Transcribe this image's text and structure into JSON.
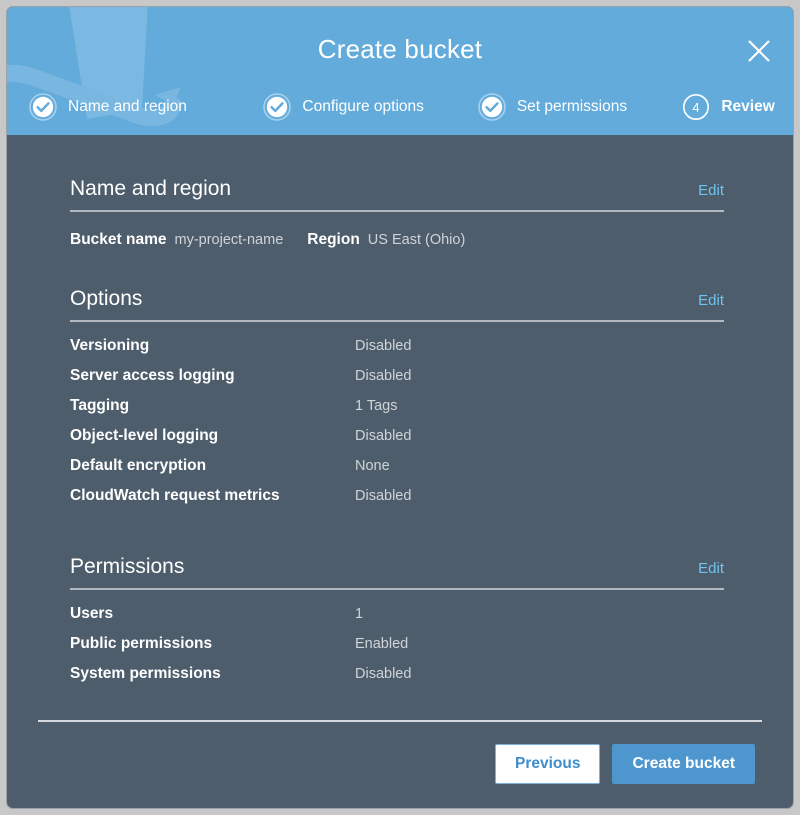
{
  "dialog": {
    "title": "Create bucket",
    "close_icon": "close-icon",
    "accent_blue": "#62abdb",
    "body_bg": "#4e5d6b",
    "link_blue": "#6fc3ef"
  },
  "steps": [
    {
      "label": "Name and region",
      "state": "complete",
      "icon": "check-circle-icon",
      "number": "1"
    },
    {
      "label": "Configure options",
      "state": "complete",
      "icon": "check-circle-icon",
      "number": "2"
    },
    {
      "label": "Set permissions",
      "state": "complete",
      "icon": "check-circle-icon",
      "number": "3"
    },
    {
      "label": "Review",
      "state": "current",
      "icon": "step-number-icon",
      "number": "4"
    }
  ],
  "sections": [
    {
      "title": "Name and region",
      "edit_label": "Edit",
      "inline": [
        {
          "key": "Bucket name",
          "value": "my-project-name"
        },
        {
          "key": "Region",
          "value": "US East (Ohio)"
        }
      ]
    },
    {
      "title": "Options",
      "edit_label": "Edit",
      "rows": [
        {
          "key": "Versioning",
          "value": "Disabled"
        },
        {
          "key": "Server access logging",
          "value": "Disabled"
        },
        {
          "key": "Tagging",
          "value": "1 Tags"
        },
        {
          "key": "Object-level logging",
          "value": "Disabled"
        },
        {
          "key": "Default encryption",
          "value": "None"
        },
        {
          "key": "CloudWatch request metrics",
          "value": "Disabled"
        }
      ]
    },
    {
      "title": "Permissions",
      "edit_label": "Edit",
      "rows": [
        {
          "key": "Users",
          "value": "1"
        },
        {
          "key": "Public permissions",
          "value": "Enabled"
        },
        {
          "key": "System permissions",
          "value": "Disabled"
        }
      ]
    }
  ],
  "footer": {
    "previous_label": "Previous",
    "create_label": "Create bucket"
  }
}
